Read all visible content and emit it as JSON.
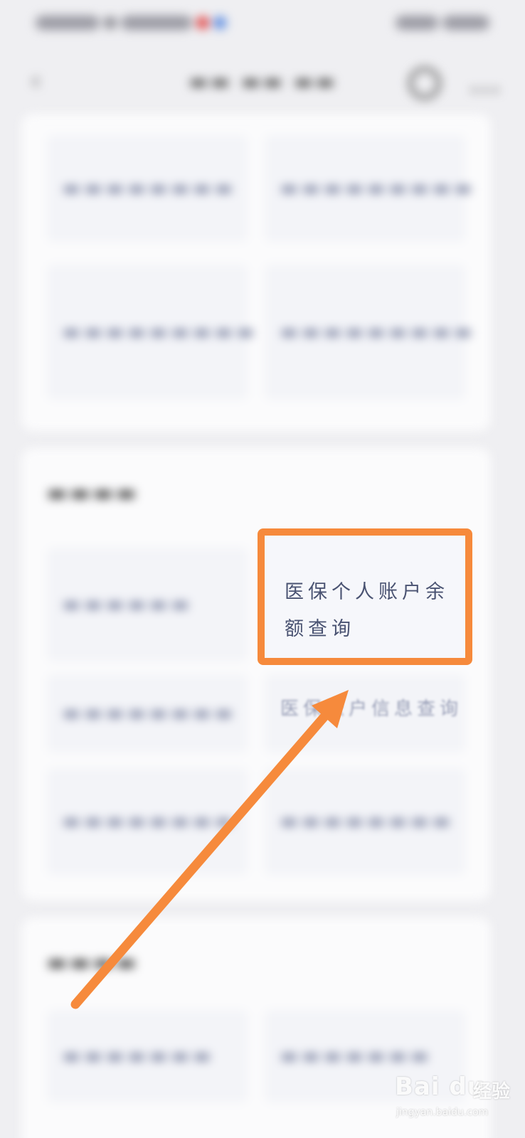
{
  "highlighted_tile": {
    "label": "医保个人账户余额查询"
  },
  "partial_tile": {
    "label": "医保账户信息查询"
  },
  "watermark": {
    "brand": "Bai du",
    "suffix": "经验",
    "url": "jingyan.baidu.com"
  },
  "colors": {
    "highlight": "#f68a3c",
    "background": "#efeff2",
    "card": "#fbfbfc",
    "tile": "#f3f4f8",
    "text": "#4a5372"
  },
  "icons": {
    "back": "chevron-left-icon",
    "settings": "gear-icon",
    "more": "more-dots-icon"
  }
}
